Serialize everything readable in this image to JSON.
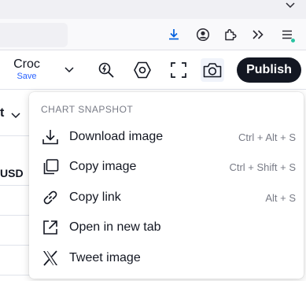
{
  "toolbar": {
    "layout_title": "Croc",
    "layout_subtitle": "Save",
    "publish_label": "Publish"
  },
  "left_panel": {
    "partial_text_1": "t",
    "partial_text_2": "USD"
  },
  "snapshot_menu": {
    "header": "CHART SNAPSHOT",
    "items": [
      {
        "label": "Download image",
        "shortcut": "Ctrl + Alt + S",
        "icon": "download-icon"
      },
      {
        "label": "Copy image",
        "shortcut": "Ctrl + Shift + S",
        "icon": "copy-icon"
      },
      {
        "label": "Copy link",
        "shortcut": "Alt + S",
        "icon": "link-icon"
      },
      {
        "label": "Open in new tab",
        "shortcut": "",
        "icon": "open-external-icon"
      },
      {
        "label": "Tweet image",
        "shortcut": "",
        "icon": "x-logo-icon"
      }
    ]
  },
  "colors": {
    "accent_blue": "#2962ff",
    "publish_bg": "#131722",
    "muted_text": "#787b86",
    "extension_dot": "#2ac3a2"
  }
}
